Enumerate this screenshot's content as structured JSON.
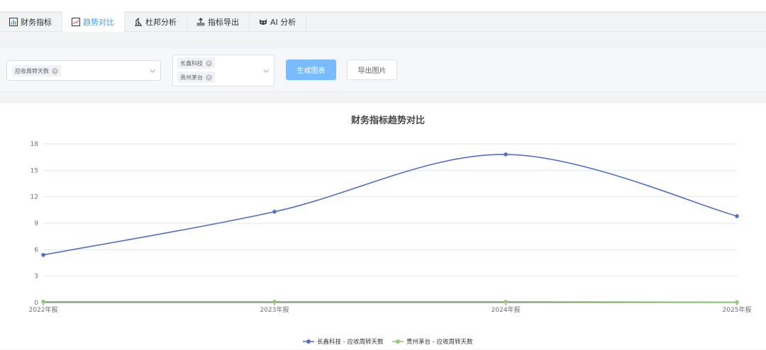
{
  "tabs": [
    {
      "label": "财务指标",
      "icon": "bar-chart-icon",
      "active": false
    },
    {
      "label": "趋势对比",
      "icon": "trend-chart-icon",
      "active": true
    },
    {
      "label": "杜邦分析",
      "icon": "dupont-icon",
      "active": false
    },
    {
      "label": "指标导出",
      "icon": "export-icon",
      "active": false
    },
    {
      "label": "AI 分析",
      "icon": "ai-icon",
      "active": false
    }
  ],
  "filters": {
    "indicator_tags": [
      "应收周转天数"
    ],
    "company_tags": [
      "长鑫科技",
      "贵州茅台"
    ],
    "generate_button": "生成图表",
    "export_button": "导出图片"
  },
  "colors": {
    "accent": "#409eff",
    "series1": "#5470c6",
    "series2": "#91cc75"
  },
  "chart_data": {
    "type": "line",
    "title": "财务指标趋势对比",
    "categories": [
      "2022年报",
      "2023年报",
      "2024年报",
      "2025年报"
    ],
    "ylim": [
      0,
      18
    ],
    "yticks": [
      0,
      3,
      6,
      9,
      12,
      15,
      18
    ],
    "grid": true,
    "smooth": true,
    "legend_position": "bottom-center",
    "series": [
      {
        "name": "长鑫科技 - 应收周转天数",
        "values": [
          5.4,
          10.3,
          16.8,
          9.8
        ]
      },
      {
        "name": "贵州茅台 - 应收周转天数",
        "values": [
          0.1,
          0.1,
          0.1,
          0.05
        ]
      }
    ]
  }
}
